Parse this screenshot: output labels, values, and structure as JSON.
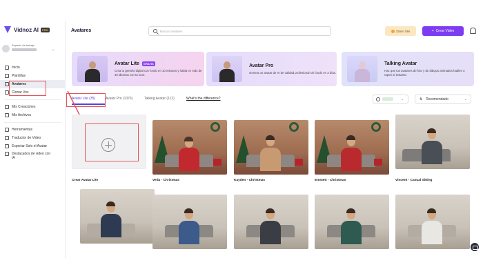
{
  "brand": {
    "name": "Vidnoz AI",
    "badge": "PRO"
  },
  "workspace": {
    "label": "Espacio de trabajo"
  },
  "nav": {
    "items": [
      {
        "label": "Inicio",
        "icon": "home-icon"
      },
      {
        "label": "Plantillas",
        "icon": "template-icon"
      },
      {
        "label": "Avatares",
        "icon": "avatar-icon",
        "active": true
      },
      {
        "label": "Clonar Voz",
        "icon": "voice-icon"
      }
    ],
    "group2": [
      {
        "label": "Mis Creaciones",
        "icon": "creations-icon"
      },
      {
        "label": "Mis Archivos",
        "icon": "files-icon"
      }
    ],
    "group3": [
      {
        "label": "Herramientas",
        "icon": "tools-icon"
      },
      {
        "label": "Traductor de Video",
        "icon": "translate-icon"
      },
      {
        "label": "Exportar Solo el Avatar",
        "icon": "export-icon"
      },
      {
        "label": "Destacados de video con IA",
        "icon": "highlight-icon"
      }
    ]
  },
  "header": {
    "title": "Avatares",
    "search_placeholder": "Buscar avatares",
    "credits": "33min 59s",
    "create_label": "Crear Video"
  },
  "cards": [
    {
      "title": "Avatar Lite",
      "badge": "GRATIS",
      "desc": "Crea tu gemelo digital con fondo en 10 minutos y habla en más de 40 idiomas con tu tono."
    },
    {
      "title": "Avatar Pro",
      "badge": "",
      "desc": "Genera un avatar de IA de calidad profesional sin fondo en 3 días."
    },
    {
      "title": "Talking Avatar",
      "badge": "",
      "desc": "Haz que tus avatares de foto y de dibujos animados hablen o rapen al instante."
    }
  ],
  "tabs": [
    {
      "label": "Avatar Lite (35)",
      "active": true
    },
    {
      "label": "Avatar Pro (1376)"
    },
    {
      "label": "Talking Avatar (112)"
    },
    {
      "label": "What's the difference?",
      "link": true
    }
  ],
  "sort": {
    "label": "Recomendado"
  },
  "grid": {
    "row1": [
      {
        "label": "Crear Avatar Lite",
        "type": "create"
      },
      {
        "label": "Veda - Christmas",
        "type": "xmas"
      },
      {
        "label": "Kayden - Christmas",
        "type": "xmas"
      },
      {
        "label": "Emmett - Christmas",
        "type": "xmas"
      },
      {
        "label": "Vincent - Casual Sitting",
        "type": "living"
      }
    ],
    "row2": [
      {
        "label": "",
        "type": "living"
      },
      {
        "label": "",
        "type": "living"
      },
      {
        "label": "",
        "type": "living"
      },
      {
        "label": "",
        "type": "living"
      },
      {
        "label": "",
        "type": "living"
      }
    ]
  },
  "colors": {
    "accent": "#7d3cf2",
    "annotation": "#e0555a",
    "tab_active": "#5b3fd6"
  }
}
